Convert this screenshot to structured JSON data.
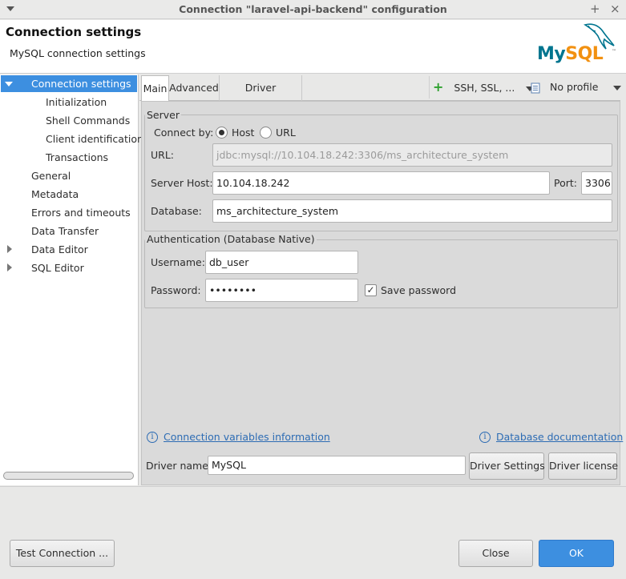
{
  "window": {
    "title": "Connection \"laravel-api-backend\" configuration",
    "pin_glyph": "+",
    "close_glyph": "×"
  },
  "header": {
    "title": "Connection settings",
    "subtitle": "MySQL connection settings",
    "logo_my": "My",
    "logo_sql": "SQL",
    "logo_tm": "™"
  },
  "sidebar": {
    "items": [
      {
        "label": "Connection settings",
        "selected": true,
        "expandable": "expanded"
      },
      {
        "label": "Initialization"
      },
      {
        "label": "Shell Commands"
      },
      {
        "label": "Client identification"
      },
      {
        "label": "Transactions"
      },
      {
        "label": "General"
      },
      {
        "label": "Metadata"
      },
      {
        "label": "Errors and timeouts"
      },
      {
        "label": "Data Transfer"
      },
      {
        "label": "Data Editor",
        "expandable": "collapsed"
      },
      {
        "label": "SQL Editor",
        "expandable": "collapsed"
      }
    ]
  },
  "tabs": [
    {
      "label": "Main",
      "active": true
    },
    {
      "label": "Advanced"
    },
    {
      "label": "Driver properties"
    }
  ],
  "toolbar": {
    "ssh_label": "SSH, SSL, ...",
    "profile_label": "No profile",
    "plus_glyph": "+"
  },
  "server": {
    "group_title": "Server",
    "connect_by_label": "Connect by:",
    "host_option": "Host",
    "url_option": "URL",
    "selected": "Host",
    "url_label": "URL:",
    "url_value": "jdbc:mysql://10.104.18.242:3306/ms_architecture_system",
    "host_label": "Server Host:",
    "host_value": "10.104.18.242",
    "port_label": "Port:",
    "port_value": "3306",
    "database_label": "Database:",
    "database_value": "ms_architecture_system"
  },
  "auth": {
    "group_title": "Authentication (Database Native)",
    "username_label": "Username:",
    "username_value": "db_user",
    "password_label": "Password:",
    "password_value": "••••••••",
    "save_password_label": "Save password",
    "save_password_checked": true,
    "check_glyph": "✓"
  },
  "links": {
    "info_glyph": "i",
    "variables": "Connection variables information",
    "docs": "Database documentation"
  },
  "driver": {
    "name_label": "Driver name:",
    "name_value": "MySQL",
    "settings_button": "Driver Settings",
    "license_button": "Driver license"
  },
  "footer": {
    "test_button": "Test Connection ...",
    "close_button": "Close",
    "ok_button": "OK"
  },
  "colors": {
    "accent": "#3d8fe0",
    "link": "#2d6cb4",
    "mysql_blue": "#00758f",
    "mysql_orange": "#f29111"
  }
}
